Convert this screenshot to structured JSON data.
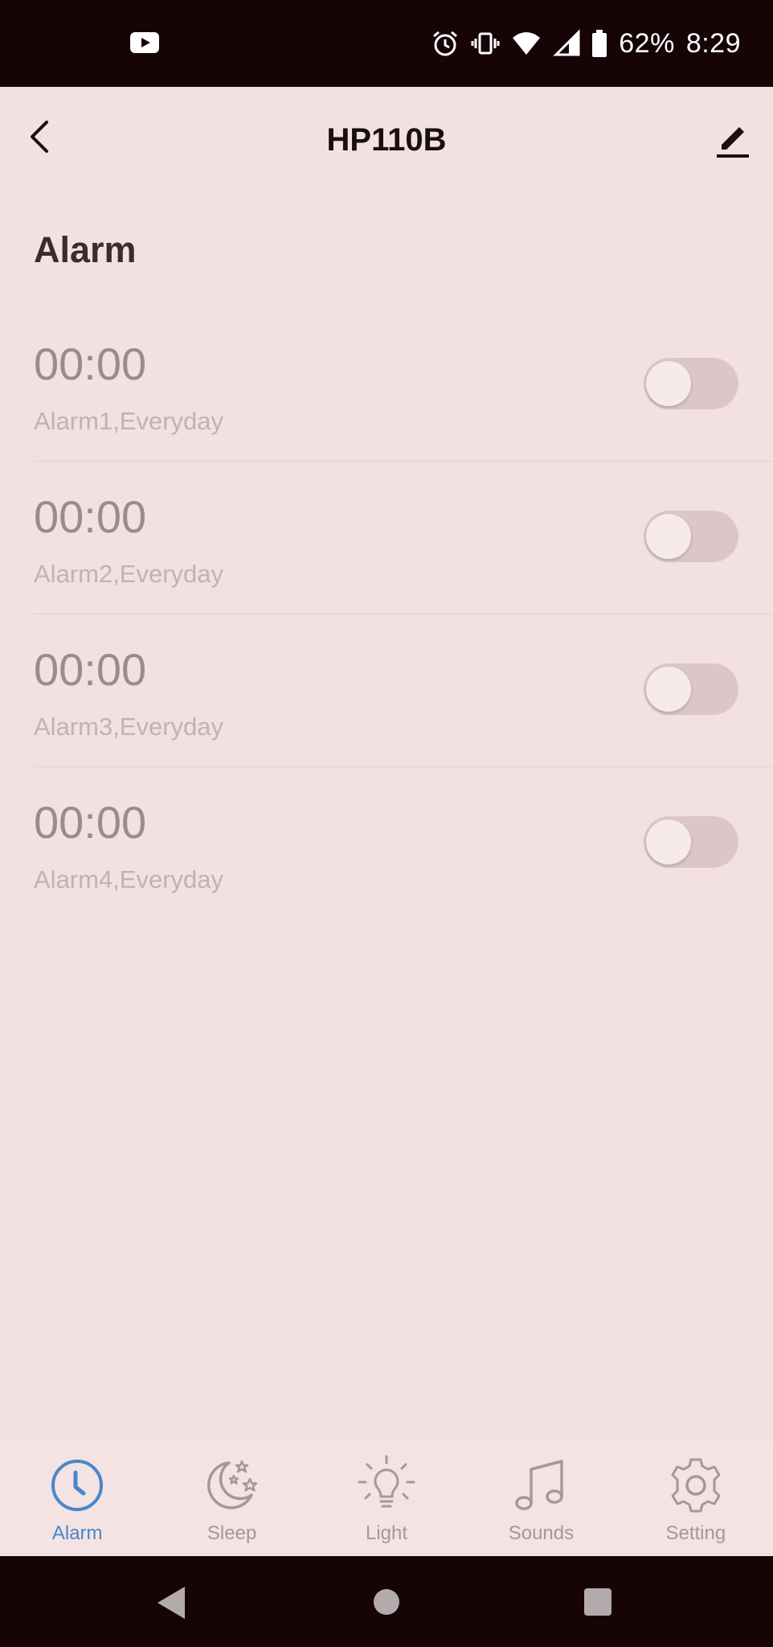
{
  "status_bar": {
    "battery": "62%",
    "time": "8:29",
    "icons": [
      "youtube-icon",
      "alarm-icon",
      "vibrate-icon",
      "wifi-icon",
      "signal-icon",
      "battery-icon"
    ]
  },
  "header": {
    "title": "HP110B",
    "back_icon": "back-arrow-icon",
    "edit_icon": "edit-pencil-icon"
  },
  "section_title": "Alarm",
  "alarms": [
    {
      "time": "00:00",
      "subtitle": "Alarm1,Everyday",
      "enabled": false
    },
    {
      "time": "00:00",
      "subtitle": "Alarm2,Everyday",
      "enabled": false
    },
    {
      "time": "00:00",
      "subtitle": "Alarm3,Everyday",
      "enabled": false
    },
    {
      "time": "00:00",
      "subtitle": "Alarm4,Everyday",
      "enabled": false
    }
  ],
  "tabs": [
    {
      "label": "Alarm",
      "icon": "clock-icon",
      "active": true
    },
    {
      "label": "Sleep",
      "icon": "moon-stars-icon",
      "active": false
    },
    {
      "label": "Light",
      "icon": "lightbulb-icon",
      "active": false
    },
    {
      "label": "Sounds",
      "icon": "music-note-icon",
      "active": false
    },
    {
      "label": "Setting",
      "icon": "gear-icon",
      "active": false
    }
  ],
  "colors": {
    "background": "#f3e1e1",
    "accent": "#4a86c9",
    "status_bar": "#160407",
    "inactive": "#a3999a"
  }
}
